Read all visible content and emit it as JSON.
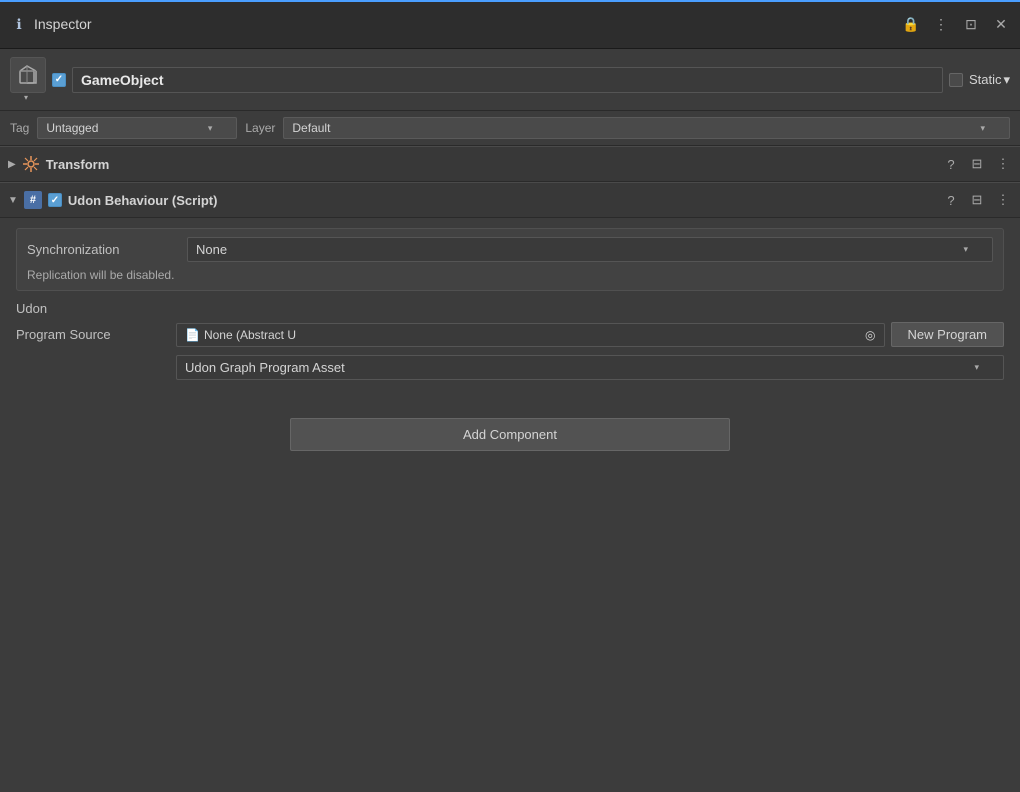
{
  "titleBar": {
    "title": "Inspector",
    "iconSymbol": "ℹ",
    "accentColor": "#4a9eff",
    "controls": {
      "lock": "🔒",
      "more": "⋮",
      "minimize": "⊡",
      "close": "✕"
    }
  },
  "gameObject": {
    "name": "GameObject",
    "checkbox_checked": true,
    "static_label": "Static",
    "static_dropdown": "▾",
    "cube_symbol": "□"
  },
  "tagLayerRow": {
    "tag_label": "Tag",
    "tag_value": "Untagged",
    "layer_label": "Layer",
    "layer_value": "Default"
  },
  "transform": {
    "title": "Transform",
    "expand_arrow": "▶",
    "icon": "✦"
  },
  "udonBehaviour": {
    "title": "Udon Behaviour (Script)",
    "expand_arrow": "▼",
    "icon": "#",
    "checkbox_checked": true,
    "synchronization": {
      "label": "Synchronization",
      "value": "None",
      "note": "Replication will be disabled."
    },
    "udon_label": "Udon",
    "programSource": {
      "label": "Program Source",
      "asset_icon": "📄",
      "asset_value": "None (Abstract U",
      "target_icon": "◎",
      "new_program_label": "New Program"
    },
    "programType": {
      "value": "Udon Graph Program Asset"
    }
  },
  "addComponent": {
    "label": "Add Component"
  },
  "icons": {
    "question": "?",
    "sliders": "⊟",
    "more_vert": "⋮",
    "chevron_down": "▾",
    "chevron_right": "▶"
  }
}
